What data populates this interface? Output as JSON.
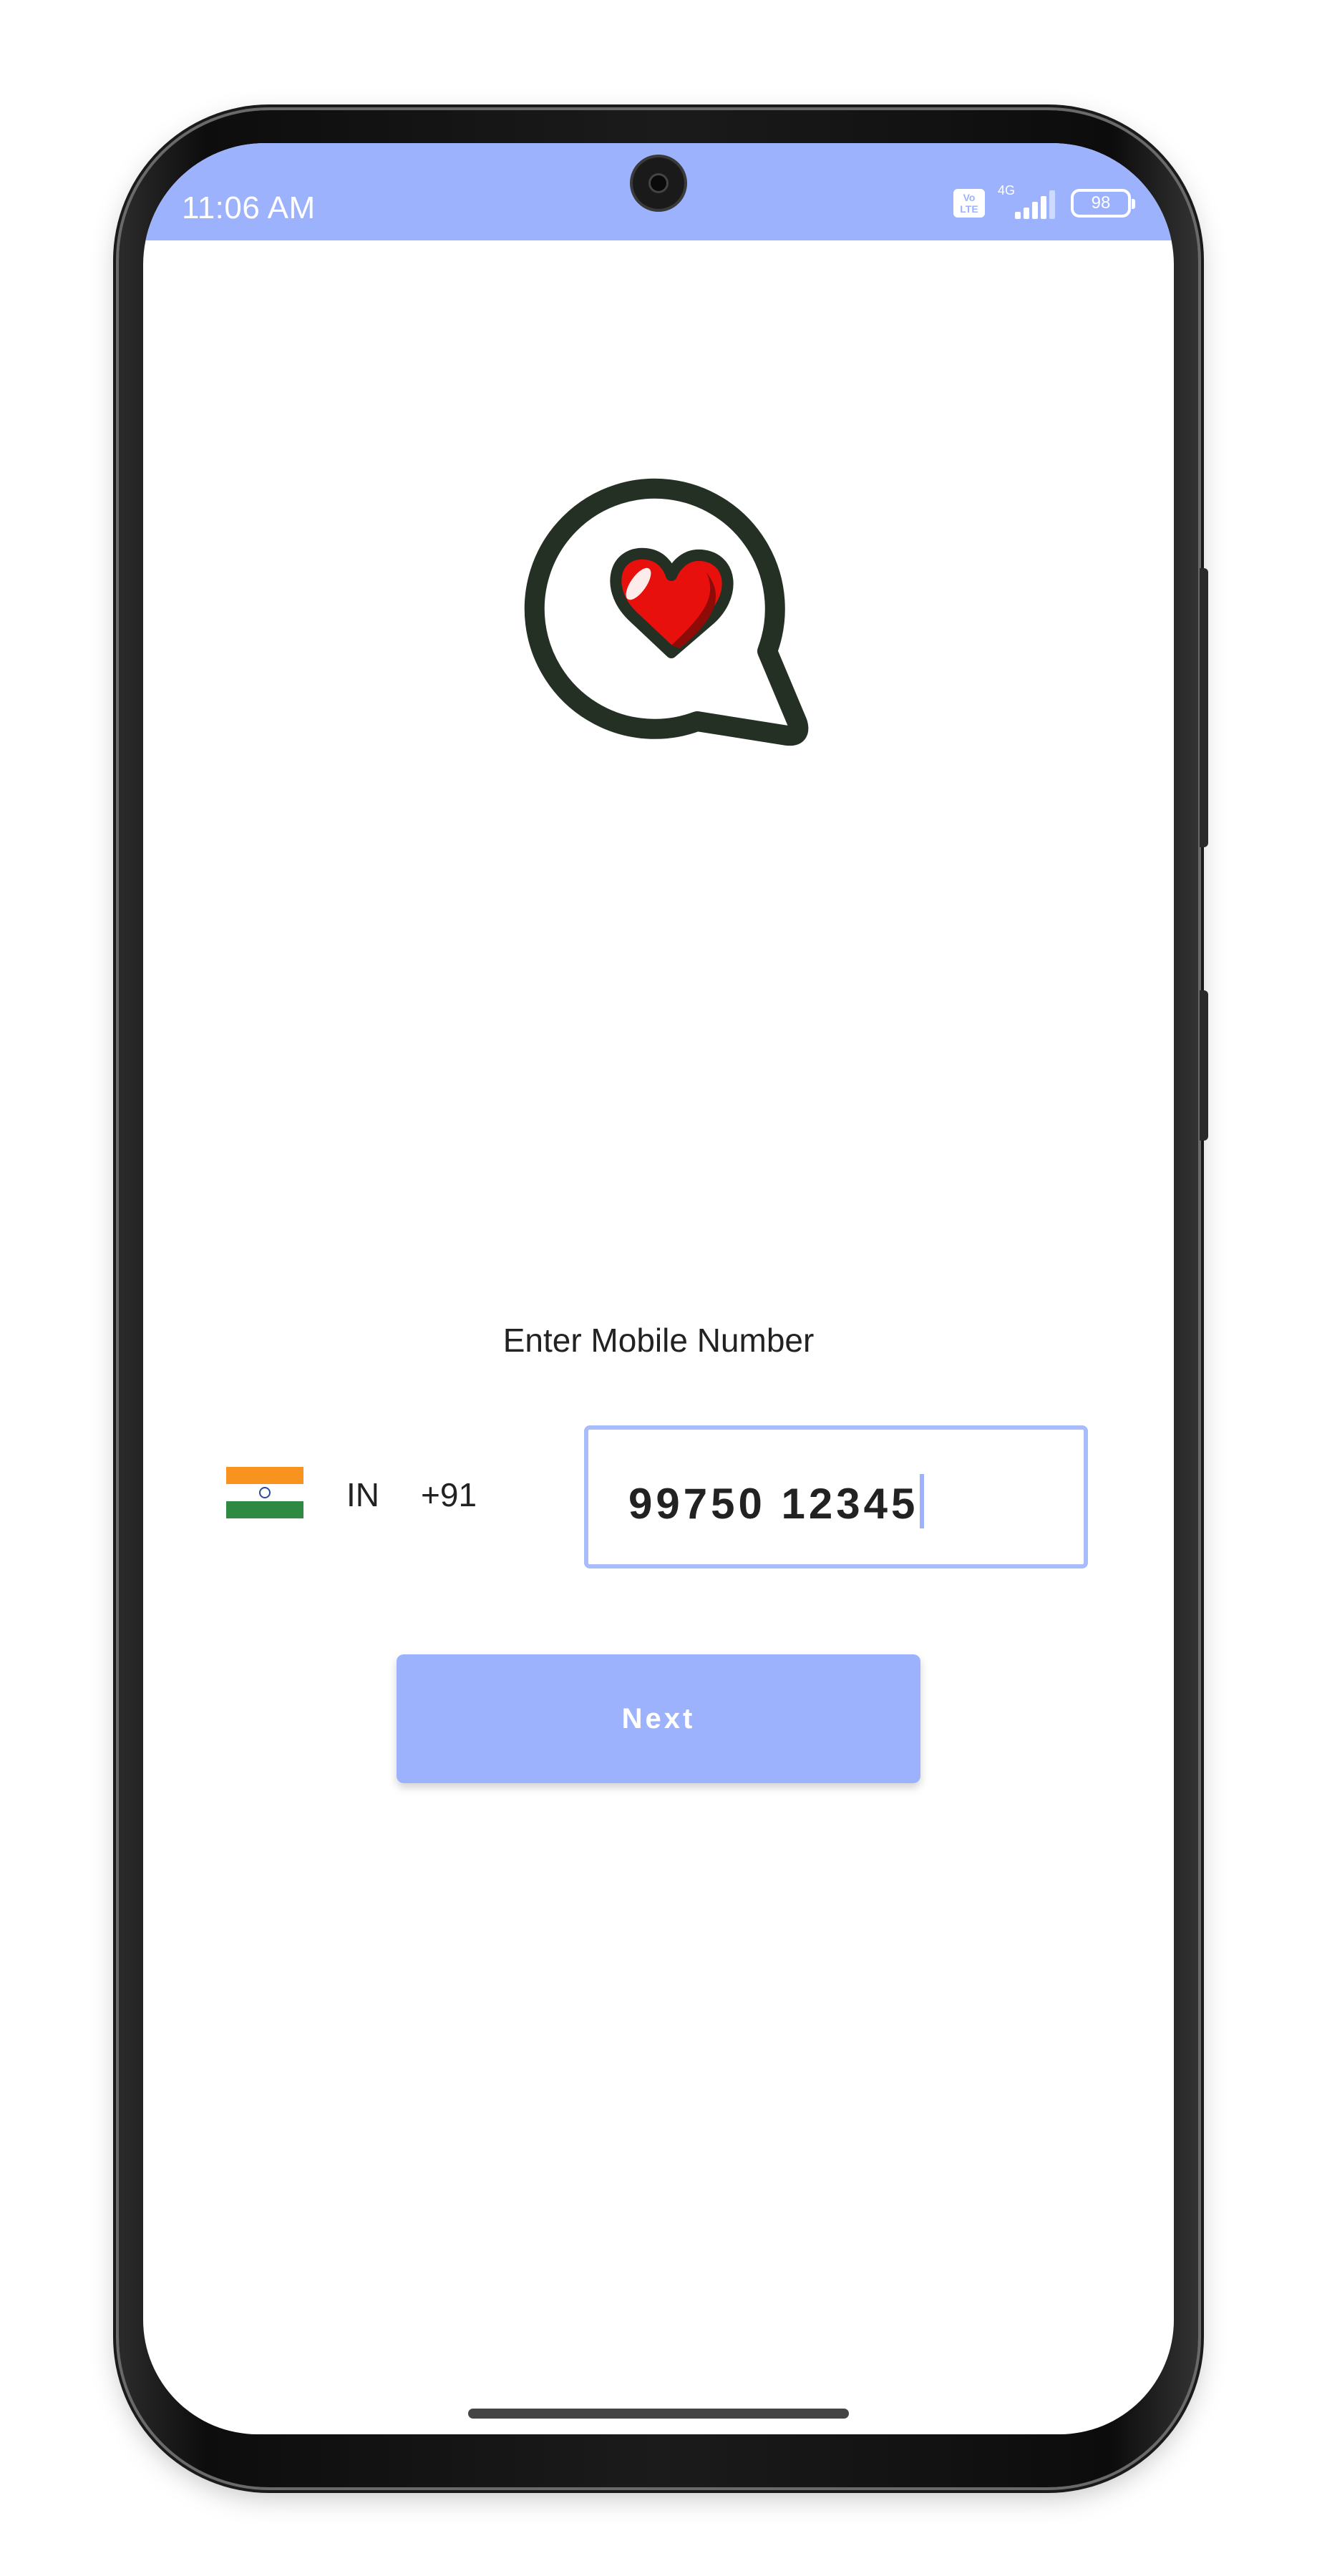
{
  "status_bar": {
    "time": "11:06 AM",
    "volte_label": "Vo LTE",
    "network_label": "4G",
    "battery_level": "98",
    "background_color": "#9db2fd"
  },
  "logo": {
    "icon": "heart-chat-bubble-icon"
  },
  "login": {
    "prompt": "Enter Mobile Number",
    "country": {
      "flag_icon": "india-flag-icon",
      "code": "IN",
      "dial_code": "+91"
    },
    "phone_number": "99750 12345",
    "next_label": "Next"
  },
  "colors": {
    "accent": "#9db2fd",
    "field_border": "#a9bcfb",
    "text": "#222222"
  }
}
